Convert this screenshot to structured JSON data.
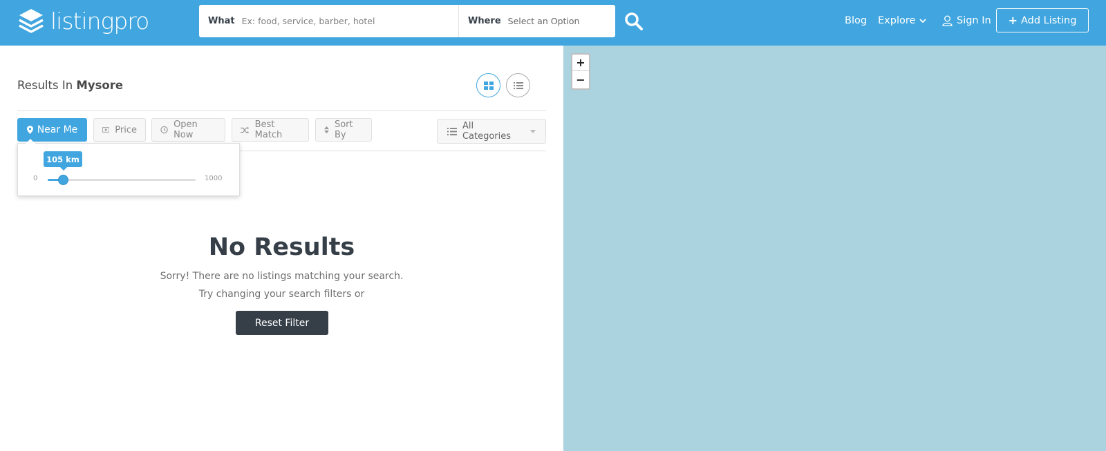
{
  "header": {
    "logo_text": "listingpro",
    "search": {
      "what_label": "What",
      "what_placeholder": "Ex: food, service, barber, hotel",
      "where_label": "Where",
      "where_value": "Select an Option"
    },
    "nav": {
      "blog": "Blog",
      "explore": "Explore",
      "sign_in": "Sign In",
      "add_listing": "Add Listing"
    },
    "accent_color": "#41a6df"
  },
  "results": {
    "prefix": "Results In",
    "city": "Mysore"
  },
  "filters": {
    "near_me": "Near Me",
    "price": "Price",
    "open_now": "Open Now",
    "best_match": "Best Match",
    "sort_by": "Sort By",
    "categories": "All Categories"
  },
  "radius": {
    "value_label": "105 km",
    "value": 105,
    "min": "0",
    "max": "1000",
    "max_value": 1000
  },
  "empty_state": {
    "title": "No Results",
    "line1": "Sorry! There are no listings matching your search.",
    "line2": "Try changing your search filters or",
    "reset_button": "Reset Filter"
  },
  "map": {
    "zoom_in": "+",
    "zoom_out": "−"
  }
}
